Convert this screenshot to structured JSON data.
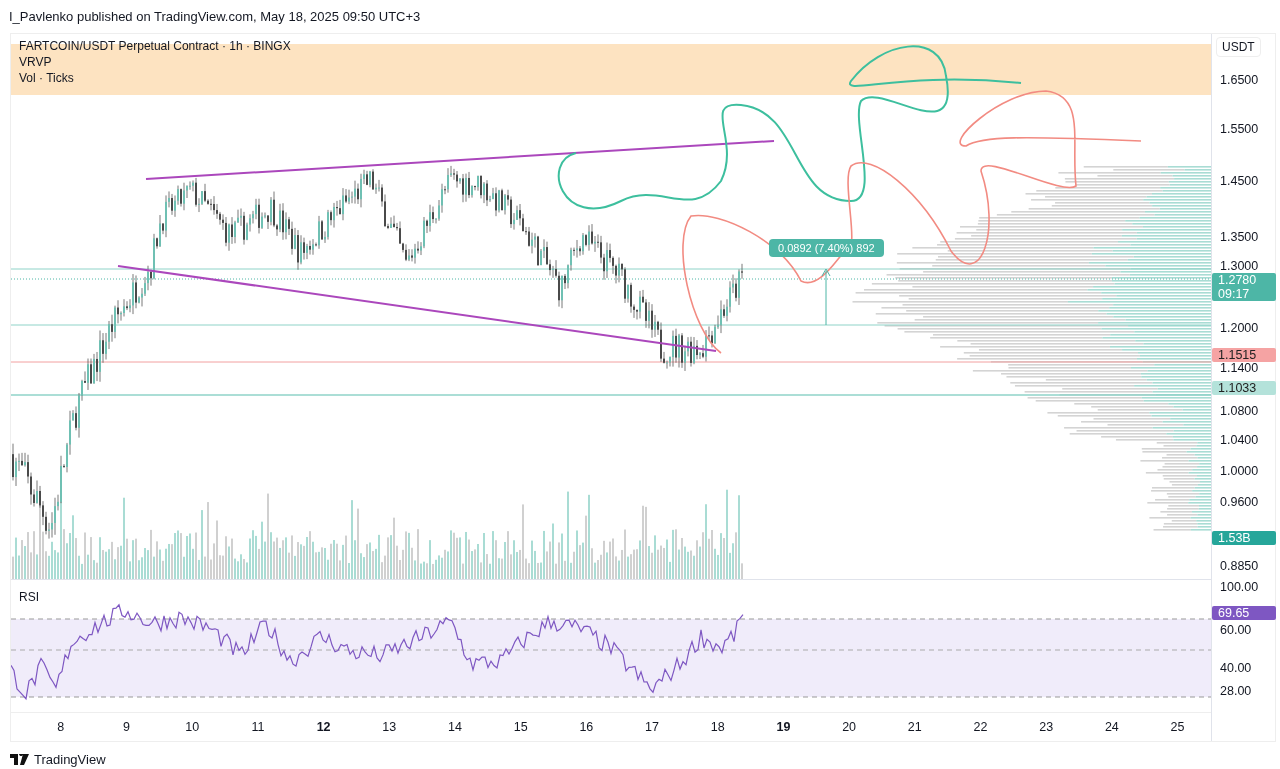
{
  "header": {
    "text": "I_Pavlenko published on TradingView.com, May 18, 2025 09:50 UTC+3"
  },
  "legend": [
    "FARTCOIN/USDT Perpetual Contract · 1h · BINGX",
    "VRVP",
    "Vol · Ticks"
  ],
  "price_axis": {
    "currency": "USDT",
    "ticks": [
      "1.6500",
      "1.5500",
      "1.4500",
      "1.3500",
      "1.3000",
      "1.2000",
      "1.1400",
      "1.0800",
      "1.0400",
      "1.0000",
      "0.9600",
      "0.8850"
    ],
    "badges": [
      {
        "kind": "last_price",
        "value": "1.2780",
        "countdown": "09:17",
        "color": "#4db6a6"
      },
      {
        "kind": "line",
        "value": "1.1515",
        "color": "#f5a3a3"
      },
      {
        "kind": "line",
        "value": "1.1033",
        "color": "#b4e2da"
      },
      {
        "kind": "volume",
        "value": "1.53B",
        "color": "#26a69a"
      }
    ]
  },
  "measure": {
    "label": "0.0892 (7.40%) 892"
  },
  "rsi": {
    "label": "RSI",
    "ticks": [
      "100.00",
      "60.00",
      "40.00",
      "28.00"
    ],
    "badge": {
      "value": "69.65",
      "color": "#7e57c2"
    }
  },
  "time_axis": [
    {
      "label": "8",
      "bold": false
    },
    {
      "label": "9",
      "bold": false
    },
    {
      "label": "10",
      "bold": false
    },
    {
      "label": "11",
      "bold": false
    },
    {
      "label": "12",
      "bold": true
    },
    {
      "label": "13",
      "bold": false
    },
    {
      "label": "14",
      "bold": false
    },
    {
      "label": "15",
      "bold": false
    },
    {
      "label": "16",
      "bold": false
    },
    {
      "label": "17",
      "bold": false
    },
    {
      "label": "18",
      "bold": false
    },
    {
      "label": "19",
      "bold": true
    },
    {
      "label": "20",
      "bold": false
    },
    {
      "label": "21",
      "bold": false
    },
    {
      "label": "22",
      "bold": false
    },
    {
      "label": "23",
      "bold": false
    },
    {
      "label": "24",
      "bold": false
    },
    {
      "label": "25",
      "bold": false
    }
  ],
  "footer": {
    "brand": "TradingView"
  }
}
